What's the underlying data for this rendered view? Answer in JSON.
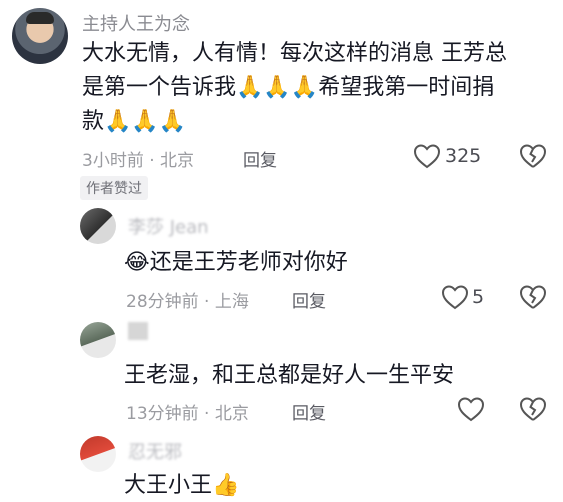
{
  "comments": [
    {
      "username": "主持人王为念",
      "content_lines": [
        "大水无情，人有情！每次这样的消息 王芳总",
        "是第一个告诉我",
        "希望我第一时间捐",
        "款"
      ],
      "time": "3小时前 · 北京",
      "reply_label": "回复",
      "like_count": "325",
      "badge": "作者赞过"
    },
    {
      "username": "李莎 Jean",
      "content": "还是王芳老师对你好",
      "time": "28分钟前 · 上海",
      "reply_label": "回复",
      "like_count": "5"
    },
    {
      "username": "王老湿",
      "content": "王老湿，和王总都是好人一生平安",
      "time": "13分钟前 · 北京",
      "reply_label": "回复",
      "like_count": ""
    },
    {
      "username": "忍无邪",
      "content": "大王小王",
      "time": "",
      "reply_label": "",
      "like_count": ""
    }
  ],
  "icons": {
    "like": "heart-outline-icon",
    "dislike": "broken-heart-icon",
    "pray": "folded-hands-emoji",
    "laugh": "laughing-tears-emoji",
    "thumb": "thumbs-up-emoji"
  }
}
